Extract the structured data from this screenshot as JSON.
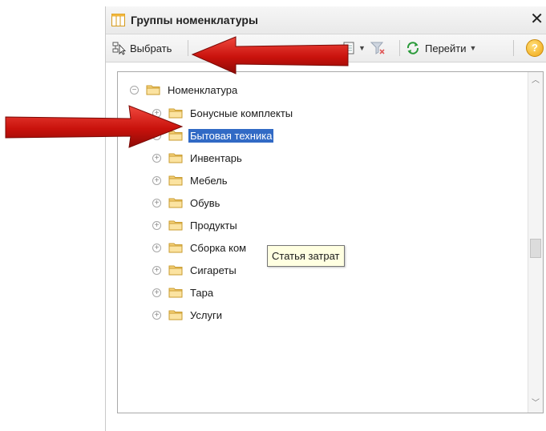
{
  "window": {
    "title": "Группы номенклатуры",
    "close_glyph": "✕"
  },
  "toolbar": {
    "select_label": "Выбрать",
    "navigate_label": "Перейти",
    "help_glyph": "?"
  },
  "tree": {
    "root": {
      "label": "Номенклатура",
      "expander": "−"
    },
    "items": [
      {
        "label": "Бонусные комплекты",
        "expander": "+"
      },
      {
        "label": "Бытовая техника",
        "expander": "+",
        "selected": true
      },
      {
        "label": "Инвентарь",
        "expander": "+"
      },
      {
        "label": "Мебель",
        "expander": "+"
      },
      {
        "label": "Обувь",
        "expander": "+"
      },
      {
        "label": "Продукты",
        "expander": "+"
      },
      {
        "label": "Сборка ком",
        "expander": "+"
      },
      {
        "label": "Сигареты",
        "expander": "+"
      },
      {
        "label": "Тара",
        "expander": "+"
      },
      {
        "label": "Услуги",
        "expander": "+"
      }
    ]
  },
  "tooltip": {
    "text": "Статья затрат"
  },
  "icons": {
    "folder": "folder-icon",
    "select": "select-icon",
    "navigate": "refresh-arrows-icon",
    "filter": "filter-clear-icon",
    "list": "list-icon",
    "help": "help-icon",
    "title": "grid-icon"
  },
  "colors": {
    "selection": "#316ac5",
    "arrow": "#d9231c",
    "tooltip_bg": "#ffffe1"
  }
}
